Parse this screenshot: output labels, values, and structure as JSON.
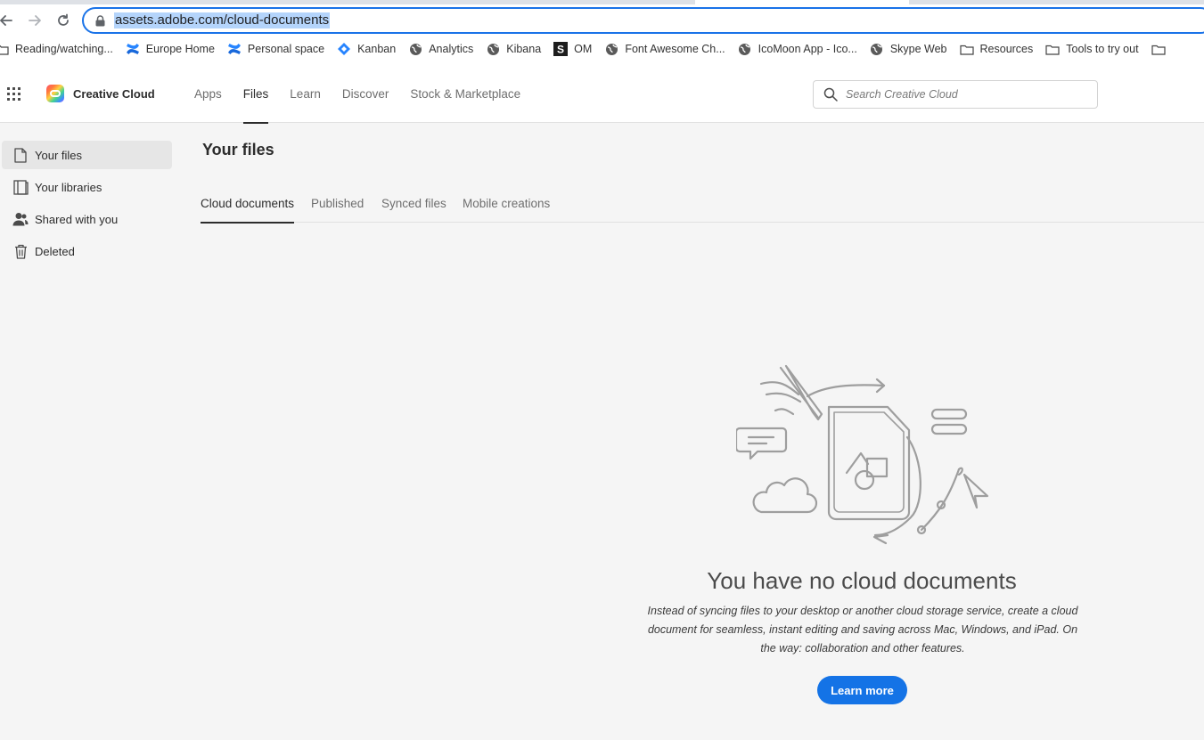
{
  "browser": {
    "url": "assets.adobe.com/cloud-documents",
    "bookmarks": [
      {
        "label": "Reading/watching...",
        "icon": "folder-icon"
      },
      {
        "label": "Europe Home",
        "icon": "confluence-icon"
      },
      {
        "label": "Personal space",
        "icon": "confluence-icon"
      },
      {
        "label": "Kanban",
        "icon": "jira-icon"
      },
      {
        "label": "Analytics",
        "icon": "globe-icon"
      },
      {
        "label": "Kibana",
        "icon": "globe-icon"
      },
      {
        "label": "OM",
        "icon": "s-icon"
      },
      {
        "label": "Font Awesome Ch...",
        "icon": "globe-icon"
      },
      {
        "label": "IcoMoon App - Ico...",
        "icon": "globe-icon"
      },
      {
        "label": "Skype Web",
        "icon": "globe-icon"
      },
      {
        "label": "Resources",
        "icon": "folder-icon"
      },
      {
        "label": "Tools to try out",
        "icon": "folder-icon"
      }
    ]
  },
  "header": {
    "brand": "Creative Cloud",
    "nav": [
      "Apps",
      "Files",
      "Learn",
      "Discover",
      "Stock & Marketplace"
    ],
    "active_nav": "Files",
    "search_placeholder": "Search Creative Cloud"
  },
  "sidebar": {
    "items": [
      {
        "label": "Your files",
        "icon": "file-icon",
        "active": true
      },
      {
        "label": "Your libraries",
        "icon": "libraries-icon",
        "active": false
      },
      {
        "label": "Shared with you",
        "icon": "users-icon",
        "active": false
      },
      {
        "label": "Deleted",
        "icon": "trash-icon",
        "active": false
      }
    ]
  },
  "main": {
    "title": "Your files",
    "tabs": [
      "Cloud documents",
      "Published",
      "Synced files",
      "Mobile creations"
    ],
    "active_tab": "Cloud documents",
    "empty_state": {
      "title": "You have no cloud documents",
      "description": "Instead of syncing files to your desktop or another cloud storage service, create a cloud document for seamless, instant editing and saving across Mac, Windows, and iPad. On the way: collaboration and other features.",
      "button": "Learn more"
    }
  },
  "colors": {
    "accent": "#1473e6",
    "omnibox_focus": "#1a73e8",
    "url_highlight": "#b4d4fb"
  }
}
